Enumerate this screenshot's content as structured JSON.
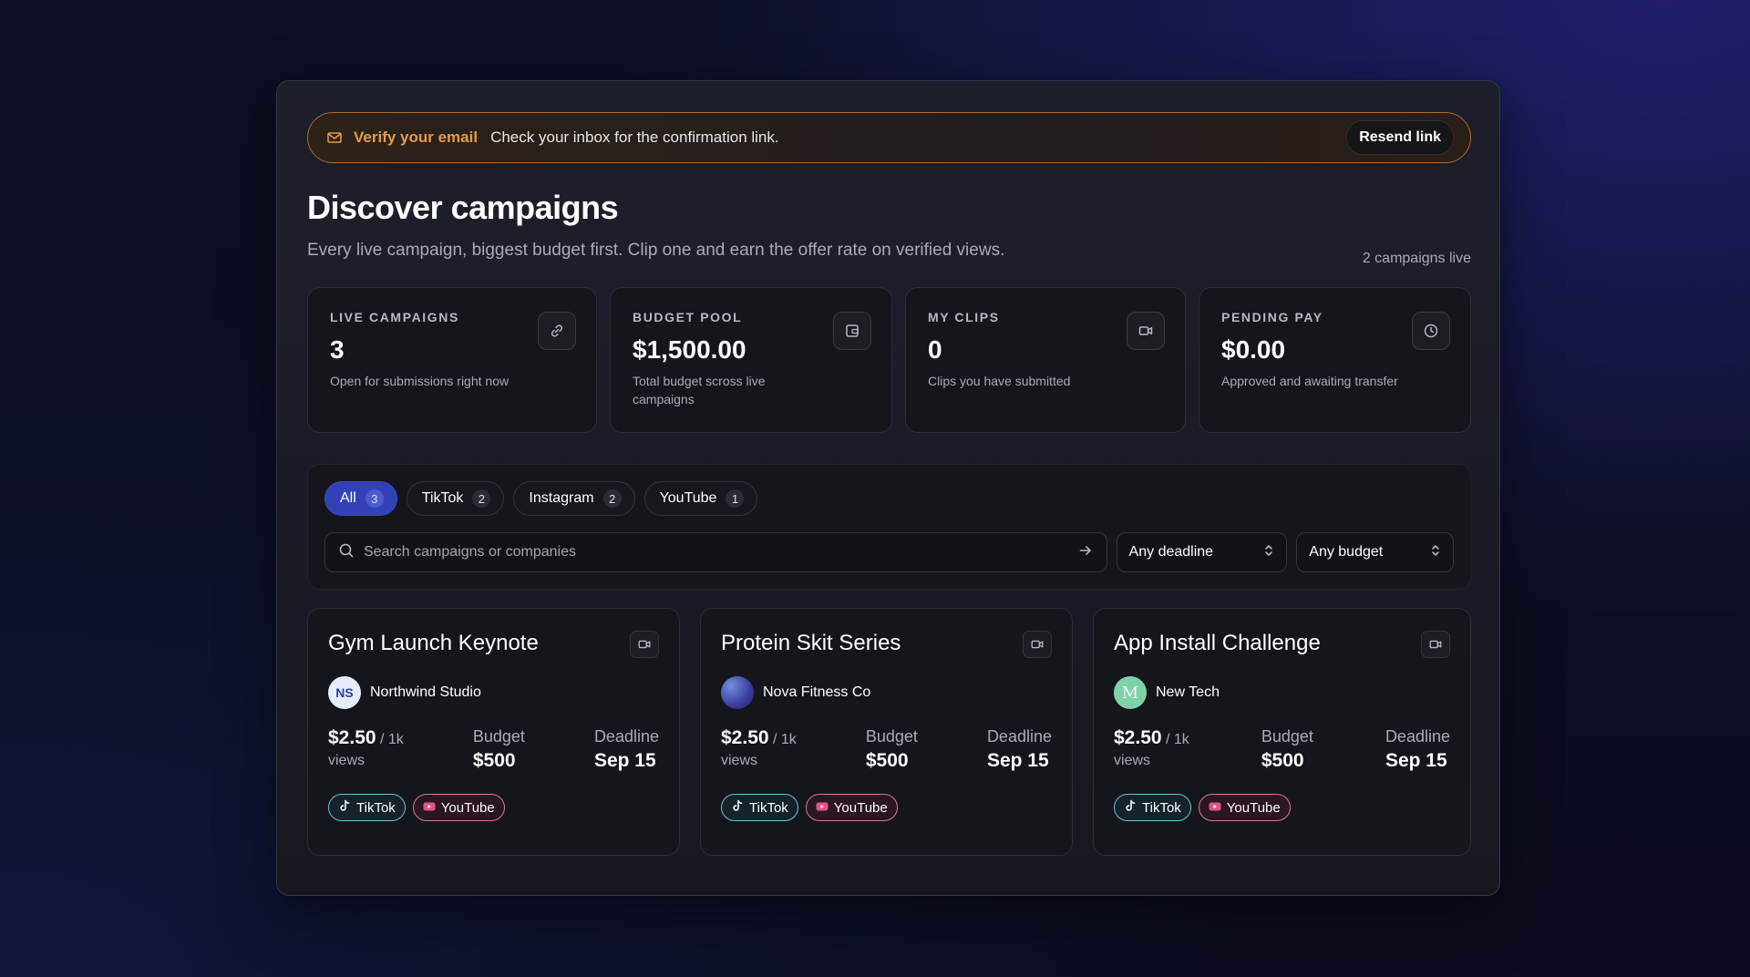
{
  "banner": {
    "title": "Verify your email",
    "message": "Check your inbox for the confirmation link.",
    "button": "Resend link",
    "icon": "mail-icon"
  },
  "header": {
    "title": "Discover campaigns",
    "subtitle": "Every live campaign, biggest budget first. Clip one and earn the offer rate on verified views.",
    "live_count": "2 campaigns live"
  },
  "stats": [
    {
      "label": "LIVE CAMPAIGNS",
      "value": "3",
      "desc": "Open for submissions right now",
      "icon": "link-icon"
    },
    {
      "label": "BUDGET POOL",
      "value": "$1,500.00",
      "desc": "Total budget scross live campaigns",
      "icon": "wallet-icon"
    },
    {
      "label": "MY CLIPS",
      "value": "0",
      "desc": "Clips you have submitted",
      "icon": "video-icon"
    },
    {
      "label": "PENDING PAY",
      "value": "$0.00",
      "desc": "Approved and awaiting transfer",
      "icon": "clock-icon"
    }
  ],
  "filters": {
    "chips": [
      {
        "label": "All",
        "count": "3",
        "active": true
      },
      {
        "label": "TikTok",
        "count": "2"
      },
      {
        "label": "Instagram",
        "count": "2"
      },
      {
        "label": "YouTube",
        "count": "1"
      }
    ],
    "search_placeholder": "Search campaigns or companies",
    "deadline": "Any deadline",
    "budget": "Any budget"
  },
  "cards": [
    {
      "title": "Gym Launch Keynote",
      "company": "Northwind Studio",
      "avatar_text": "NS",
      "rate": "$2.50",
      "rate_unit": "/ 1k",
      "views": "views",
      "budget_label": "Budget",
      "budget": "$500",
      "deadline_label": "Deadline",
      "deadline": "Sep 15",
      "tags": [
        "TikTok",
        "YouTube"
      ]
    },
    {
      "title": "Protein Skit Series",
      "company": "Nova Fitness Co",
      "avatar_text": "",
      "rate": "$2.50",
      "rate_unit": "/ 1k",
      "views": "views",
      "budget_label": "Budget",
      "budget": "$500",
      "deadline_label": "Deadline",
      "deadline": "Sep 15",
      "tags": [
        "TikTok",
        "YouTube"
      ]
    },
    {
      "title": "App Install Challenge",
      "company": "New Tech",
      "avatar_text": "M",
      "rate": "$2.50",
      "rate_unit": "/ 1k",
      "views": "views",
      "budget_label": "Budget",
      "budget": "$500",
      "deadline_label": "Deadline",
      "deadline": "Sep 15",
      "tags": [
        "TikTok",
        "YouTube"
      ]
    }
  ],
  "colors": {
    "accent": "#3241b5",
    "warning": "#e79a4a",
    "tiktok": "#6cc4d0",
    "youtube": "#d57ba2"
  }
}
